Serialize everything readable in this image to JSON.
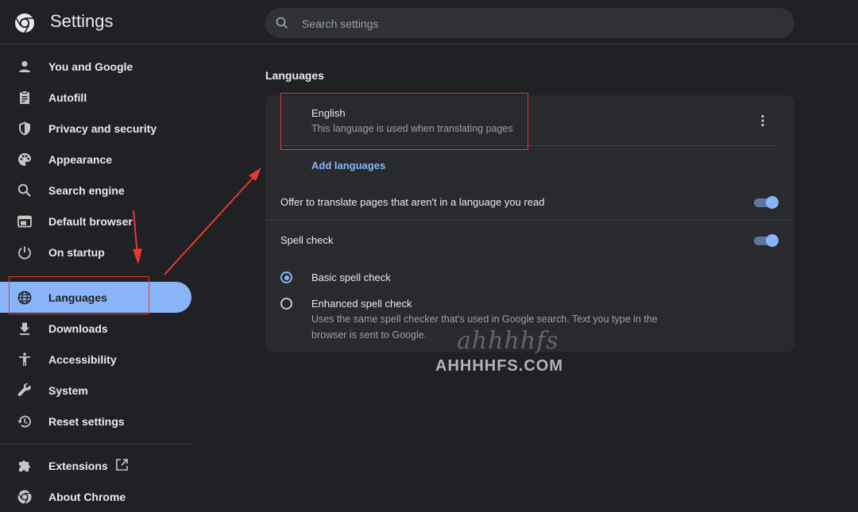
{
  "header": {
    "title": "Settings",
    "search_placeholder": "Search settings"
  },
  "sidebar": {
    "items": [
      {
        "label": "You and Google",
        "icon": "person-icon"
      },
      {
        "label": "Autofill",
        "icon": "clipboard-icon"
      },
      {
        "label": "Privacy and security",
        "icon": "shield-icon"
      },
      {
        "label": "Appearance",
        "icon": "palette-icon"
      },
      {
        "label": "Search engine",
        "icon": "search-icon"
      },
      {
        "label": "Default browser",
        "icon": "browser-window-icon"
      },
      {
        "label": "On startup",
        "icon": "power-icon"
      },
      {
        "label": "Languages",
        "icon": "globe-icon",
        "active": true
      },
      {
        "label": "Downloads",
        "icon": "download-icon"
      },
      {
        "label": "Accessibility",
        "icon": "accessibility-icon"
      },
      {
        "label": "System",
        "icon": "wrench-icon"
      },
      {
        "label": "Reset settings",
        "icon": "history-icon"
      }
    ],
    "extensions": {
      "label": "Extensions",
      "icon": "puzzle-icon",
      "link_icon": "external-link-icon"
    },
    "about": {
      "label": "About Chrome",
      "icon": "chrome-icon"
    }
  },
  "main": {
    "section_title": "Languages",
    "language": {
      "name": "English",
      "description": "This language is used when translating pages"
    },
    "add_languages": "Add languages",
    "offer_translate": {
      "label": "Offer to translate pages that aren't in a language you read",
      "enabled": true
    },
    "spell_check": {
      "label": "Spell check",
      "enabled": true
    },
    "spell_options": [
      {
        "label": "Basic spell check",
        "selected": true
      },
      {
        "label": "Enhanced spell check",
        "selected": false,
        "description": "Uses the same spell checker that's used in Google search. Text you type in the browser is sent to Google."
      }
    ]
  },
  "watermark": {
    "script": "ahhhhfs",
    "text": "AHHHHFS.COM"
  },
  "colors": {
    "background": "#202124",
    "card": "#292a2d",
    "accent": "#8ab4f8",
    "annotation": "#e53935"
  }
}
